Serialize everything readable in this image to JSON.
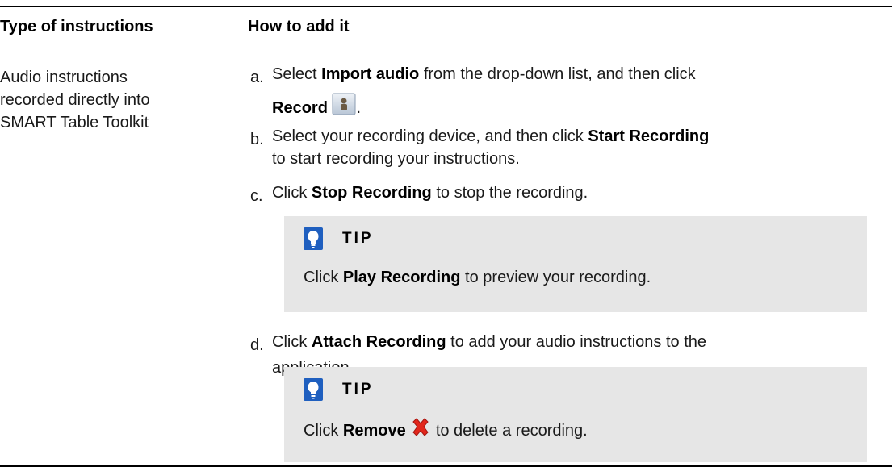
{
  "table": {
    "headers": {
      "type": "Type of instructions",
      "how": "How to add it"
    },
    "row": {
      "type_lines": [
        "Audio instructions",
        "recorded directly into",
        "SMART Table Toolkit"
      ]
    }
  },
  "steps": [
    {
      "letter": "a.",
      "p1": "Select ",
      "b1": "Import audio",
      "p2": " from the drop-down list, and then click",
      "b2": "Record",
      "p3": ".",
      "icon": "record-icon"
    },
    {
      "letter": "b.",
      "p1": "Select your recording device, and then click ",
      "b1": "Start Recording",
      "p2": "to start recording your instructions."
    },
    {
      "letter": "c.",
      "p1": "Click ",
      "b1": "Stop Recording",
      "p2": " to stop the recording."
    },
    {
      "letter": "d.",
      "p1": "Click ",
      "b1": "Attach Recording",
      "p2": " to add your audio instructions to the",
      "p3": "application."
    }
  ],
  "tips": [
    {
      "label": "TIP",
      "p1": "Click ",
      "b1": "Play Recording",
      "p2": " to preview your recording.",
      "icon": "lightbulb-icon"
    },
    {
      "label": "TIP",
      "p1": "Click ",
      "b1": "Remove",
      "p2": " to delete a recording.",
      "icon": "lightbulb-icon",
      "inline_icon": "remove-x-icon"
    }
  ],
  "colors": {
    "tip_bg": "#e6e6e6",
    "tip_icon": "#1f5fbf",
    "remove_icon": "#e2261b"
  }
}
